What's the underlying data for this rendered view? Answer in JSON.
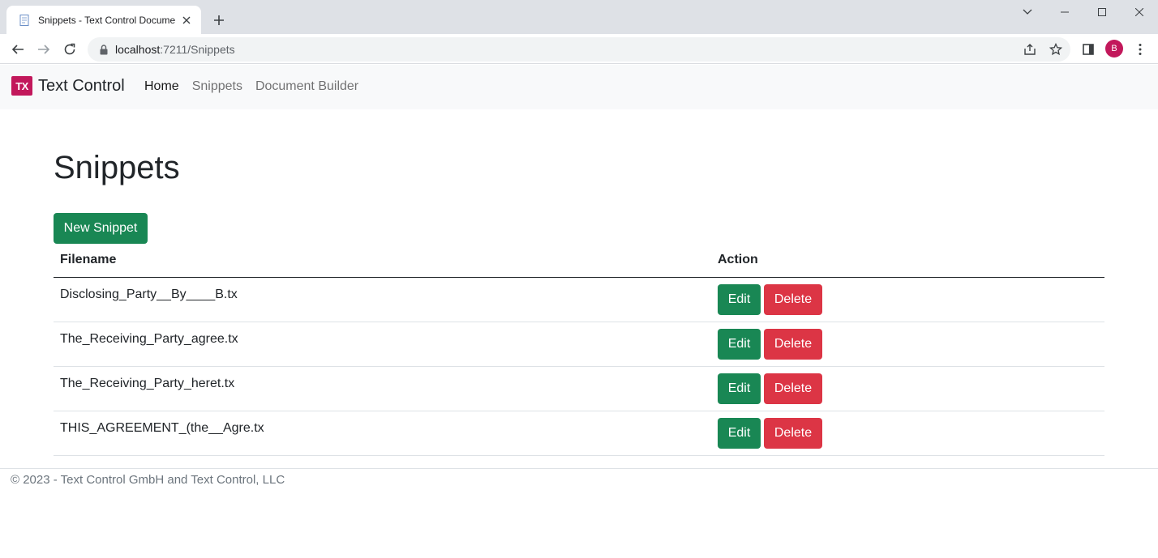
{
  "browser": {
    "tab_title": "Snippets - Text Control Document Builder",
    "url_host": "localhost",
    "url_rest": ":7211/Snippets",
    "profile_initial": "B"
  },
  "navbar": {
    "brand_logo": "TX",
    "brand_name": "Text Control",
    "links": [
      {
        "label": "Home"
      },
      {
        "label": "Snippets"
      },
      {
        "label": "Document Builder"
      }
    ]
  },
  "page": {
    "title": "Snippets",
    "new_button": "New Snippet"
  },
  "table": {
    "headers": [
      "Filename",
      "Action"
    ],
    "rows": [
      {
        "filename": "Disclosing_Party__By____B.tx",
        "edit": "Edit",
        "delete": "Delete"
      },
      {
        "filename": "The_Receiving_Party_agree.tx",
        "edit": "Edit",
        "delete": "Delete"
      },
      {
        "filename": "The_Receiving_Party_heret.tx",
        "edit": "Edit",
        "delete": "Delete"
      },
      {
        "filename": "THIS_AGREEMENT_(the__Agre.tx",
        "edit": "Edit",
        "delete": "Delete"
      }
    ]
  },
  "footer": {
    "text": "© 2023 - Text Control GmbH and Text Control, LLC"
  },
  "colors": {
    "success": "#198754",
    "danger": "#dc3545",
    "brand": "#c2185b"
  }
}
